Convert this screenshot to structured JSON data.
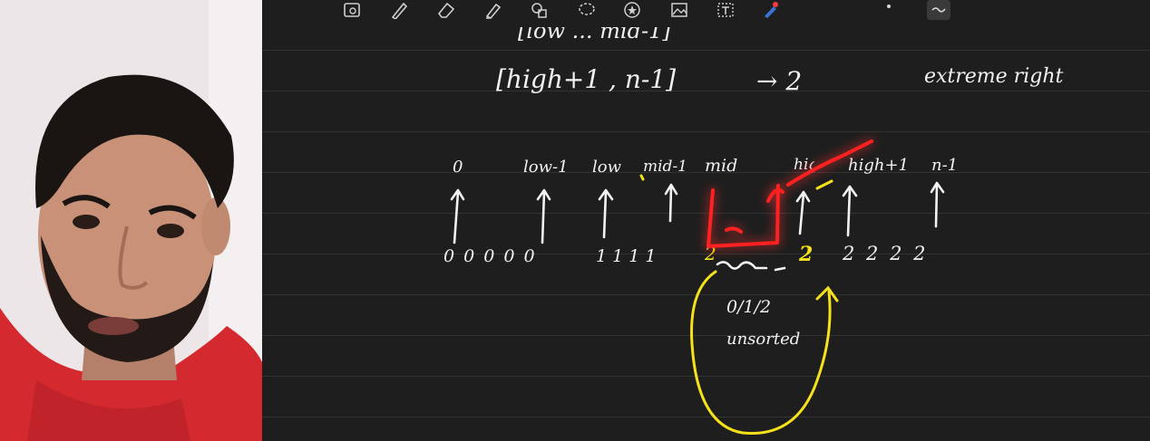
{
  "toolbar": {
    "tools": [
      {
        "name": "lasso-select-icon"
      },
      {
        "name": "pen-icon"
      },
      {
        "name": "eraser-icon"
      },
      {
        "name": "highlighter-icon"
      },
      {
        "name": "shapes-icon"
      },
      {
        "name": "lasso-icon"
      },
      {
        "name": "sticker-star-icon"
      },
      {
        "name": "image-icon"
      },
      {
        "name": "text-box-icon"
      },
      {
        "name": "laser-pointer-icon"
      },
      {
        "name": "more-dot-icon"
      },
      {
        "name": "stroke-style-icon"
      }
    ]
  },
  "notes": {
    "line1": "[low ... mid-1]",
    "line2_range": "[high+1 , n-1]",
    "line2_arrow": "→ 2",
    "line2_label": "extreme right",
    "indices": {
      "i0": "0",
      "low_minus_1": "low-1",
      "low": "low",
      "mid_minus_1": "mid-1",
      "mid": "mid",
      "high": "high",
      "high_plus_1": "high+1",
      "n_minus_1": "n-1"
    },
    "values": {
      "zeros": "0  0 0 0 0",
      "ones": "1  1  1  1",
      "unsorted_mark": "2",
      "two_yellow": "2",
      "twos": "2 2 2 2"
    },
    "annotation_line1": "0/1/2",
    "annotation_line2": "unsorted"
  },
  "colors": {
    "board": "#1e1e1e",
    "ink_white": "#f2f2f2",
    "ink_yellow": "#f5e21b",
    "ink_red": "#ff2020",
    "hoodie": "#d42a2f"
  }
}
